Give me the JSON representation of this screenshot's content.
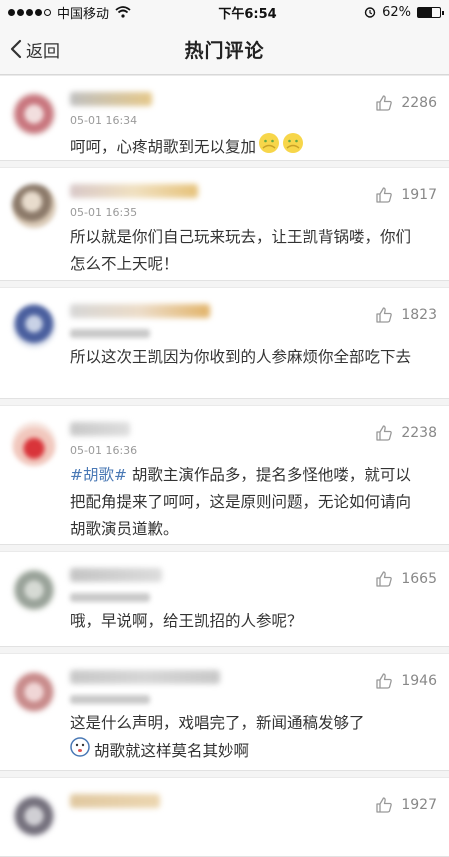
{
  "status_bar": {
    "carrier": "中国移动",
    "time": "下午6:54",
    "battery_text": "62%",
    "battery_level": 0.62,
    "signal_bars": 4,
    "icons": [
      "signal-icon",
      "wifi-icon",
      "alarm-icon",
      "battery-icon"
    ]
  },
  "nav": {
    "back_label": "返回",
    "title": "热门评论"
  },
  "comments": [
    {
      "time": "05-01 16:34",
      "likes": "2286",
      "text": "呵呵，心疼胡歌到无以复加"
    },
    {
      "time": "05-01 16:35",
      "likes": "1917",
      "text": "所以就是你们自己玩来玩去，让王凯背锅喽，你们怎么不上天呢！"
    },
    {
      "time": "",
      "likes": "1823",
      "text": "所以这次王凯因为你收到的人参麻烦你全部吃下去"
    },
    {
      "time": "05-01 16:36",
      "likes": "2238",
      "hashtag": "#胡歌#",
      "text": " 胡歌主演作品多，提名多怪他喽，就可以把配角提来了呵呵，这是原则问题，无论如何请向胡歌演员道歉。"
    },
    {
      "time": "",
      "likes": "1665",
      "text": "哦，早说啊，给王凯招的人参呢？"
    },
    {
      "time": "",
      "likes": "1946",
      "text_line1": "这是什么声明，戏唱完了，新闻通稿发够了",
      "text_line2": "胡歌就这样莫名其妙啊"
    },
    {
      "time": "",
      "likes": "1927",
      "text": ""
    }
  ]
}
